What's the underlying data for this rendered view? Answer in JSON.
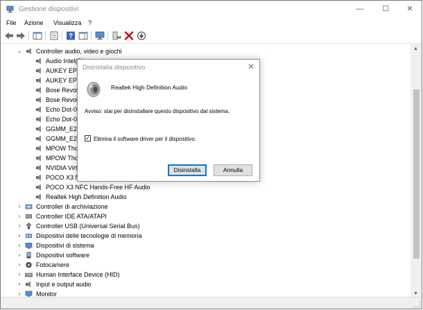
{
  "window": {
    "title": "Gestione dispositivi",
    "minimize": "—",
    "maximize": "☐",
    "close": "✕"
  },
  "menu": [
    "File",
    "Azione",
    "Visualizza",
    "?"
  ],
  "tree": {
    "expanded_category": "Controller audio, video e giochi",
    "children": [
      "Audio Intel(R) per schermi",
      "AUKEY EP-B",
      "AUKEY EP-B",
      "Bose Revolve",
      "Bose Revolve",
      "Echo Dot-0",
      "Echo Dot-0",
      "GGMM_E2",
      "GGMM_E2",
      "MPOW Tho",
      "MPOW Tho",
      "NVIDIA Virt",
      "POCO X3 N",
      "POCO X3 NFC Hands-Free HF Audio",
      "Realtek High Definition Audio"
    ],
    "collapsed_categories": [
      "Controller di archiviazione",
      "Controller IDE ATA/ATAPI",
      "Controller USB (Universal Serial Bus)",
      "Dispositivi delle tecnologie di memoria",
      "Dispositivi di sistema",
      "Dispositivi software",
      "Fotocamere",
      "Human Interface Device (HID)",
      "Input e output audio",
      "Monitor"
    ]
  },
  "dialog": {
    "title": "Disinstalla dispositivo",
    "device_name": "Realtek High Definition Audio",
    "warning": "Avviso: stai per disinstallare questo dispositivo dal sistema.",
    "checkbox_label": "Elimina il software driver per il dispositivo.",
    "checkbox_checked": true,
    "check_mark": "✓",
    "close": "✕",
    "uninstall_label": "Disinstalla",
    "cancel_label": "Annulla"
  },
  "colors": {
    "accent": "#0078d7",
    "remove_red": "#d0021b",
    "enable_green": "#2f8f2f"
  }
}
